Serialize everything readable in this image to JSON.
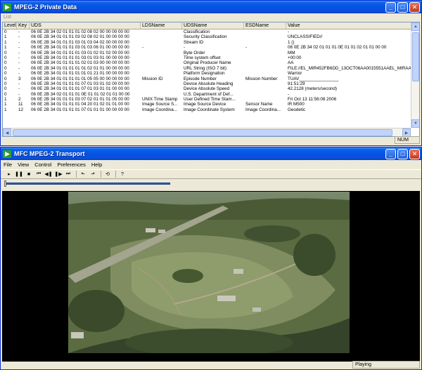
{
  "private_window": {
    "title": "MPEG-2 Private Data",
    "list_label": "List",
    "columns": [
      "Level",
      "Key",
      "UDS",
      "LDSName",
      "UDSName",
      "ESDName",
      "Value"
    ],
    "rows": [
      [
        "0",
        "-",
        "06 0E 2B 34 02 01 01 01 02 08 02 00 00 00 00 00",
        "",
        "Classification",
        "",
        "-"
      ],
      [
        "1",
        "-",
        "06 0E 2B 34 01 01 01 03 02 08 02 01 00 00 00 00",
        "",
        "Security Classification",
        "",
        "UNCLASSIFIED//"
      ],
      [
        "1",
        "-",
        "06 0E 2B 34 01 01 01 03 01 03 04 02 00 00 00 00",
        "",
        "Stream ID",
        "",
        "1 ()"
      ],
      [
        "1",
        "-",
        "06 0E 2B 34 01 01 01 03 01 03 06 01 00 00 00 00",
        "-",
        "-",
        "-",
        "06 0E 2B 34 02 01 01 01 0E 01 01 02 01 01 00 00"
      ],
      [
        "0",
        "-",
        "06 0E 2B 34 01 01 01 01 03 01 02 01 02 00 00 00",
        "",
        "Byte Order",
        "",
        "MM"
      ],
      [
        "0",
        "-",
        "06 0E 2B 34 01 01 01 01 03 01 03 01 00 00 00 00",
        "",
        "Time system offset",
        "",
        "+00:00"
      ],
      [
        "0",
        "-",
        "06 0E 2B 34 01 01 01 01 02 01 03 00 00 00 00 00",
        "",
        "Original Producer Name",
        "",
        "AA"
      ],
      [
        "0",
        "-",
        "06 0E 2B 34 01 01 01 01 01 02 01 01 00 00 00 00",
        "",
        "URL String (ISO 7 bit)",
        "",
        "FILE://EL_MIR452FB6DD_13OCT06AA0015551AAEL_MIRAA"
      ],
      [
        "0",
        "-",
        "06 0E 2B 34 01 01 01 01 01 01 21 01 00 00 00 00",
        "",
        "Platform Designation",
        "",
        "Warrior"
      ],
      [
        "0",
        "3",
        "06 0E 2B 34 01 01 01 01 01 05 05 00 00 00 00 00",
        "Mission ID",
        "Episode Number",
        "Mission Number",
        "TUAV________________"
      ],
      [
        "0",
        "-",
        "06 0E 2B 34 01 01 01 01 07 01 03 01 02 00 00 00",
        "",
        "Device Absolute Heading",
        "",
        "91:51:29"
      ],
      [
        "0",
        "-",
        "06 0E 2B 34 01 01 01 01 07 01 03 01 01 00 00 00",
        "",
        "Device Absolute Speed",
        "",
        "42.2128 (meters/second)"
      ],
      [
        "0",
        "-",
        "06 0E 2B 34 02 01 01 01 0E 01 01 02 01 01 00 00",
        "",
        "U.S. Department of Def...",
        "",
        "-"
      ],
      [
        "1",
        "2",
        "06 0E 2B 34 01 01 01 03 07 02 01 01 01 05 00 00",
        "UNIX Time Stamp",
        "User Defined Time Stam...",
        "",
        "Fri Oct 13 11:56:08 2006"
      ],
      [
        "1",
        "11",
        "06 0E 2B 34 01 01 01 01 04 20 01 02 01 01 00 00",
        "Image Source S...",
        "Image Source Device",
        "Sensor Name",
        "IR M500"
      ],
      [
        "1",
        "12",
        "06 0E 2B 34 01 01 01 01 07 01 01 01 00 00 00 00",
        "Image Coordina...",
        "Image Coordinate System",
        "Image Coordina...",
        "Geodetic"
      ]
    ],
    "status_num": "NUM"
  },
  "transport_window": {
    "title": "MFC MPEG-2 Transport",
    "menus": [
      "File",
      "View",
      "Control",
      "Preferences",
      "Help"
    ],
    "toolbar": [
      "play-icon",
      "pause-icon",
      "stop-icon",
      "skip-start-icon",
      "step-back-icon",
      "step-forward-icon",
      "skip-end-icon",
      "mark-in-icon",
      "mark-out-icon",
      "loop-icon",
      "info-icon"
    ],
    "status_text": "Playing"
  }
}
